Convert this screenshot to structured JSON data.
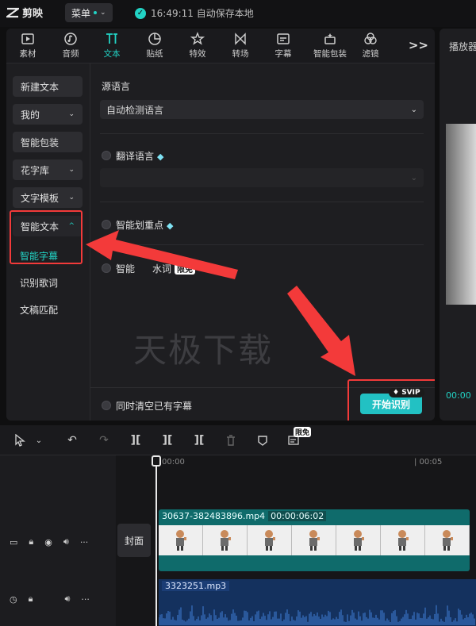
{
  "app": {
    "name": "剪映",
    "menu_label": "菜单",
    "save_status": "16:49:11 自动保存本地"
  },
  "toolbar": {
    "tabs": [
      {
        "label": "素材",
        "icon": "media-icon"
      },
      {
        "label": "音频",
        "icon": "audio-icon"
      },
      {
        "label": "文本",
        "icon": "text-icon",
        "active": true
      },
      {
        "label": "贴纸",
        "icon": "sticker-icon"
      },
      {
        "label": "特效",
        "icon": "effects-icon"
      },
      {
        "label": "转场",
        "icon": "transition-icon"
      },
      {
        "label": "字幕",
        "icon": "subtitle-icon"
      },
      {
        "label": "智能包装",
        "icon": "smart-pack-icon"
      },
      {
        "label": "滤镜",
        "icon": "filter-icon"
      }
    ],
    "more": ">>"
  },
  "sidebar": {
    "new_text": "新建文本",
    "mine": "我的",
    "smart_pack": "智能包装",
    "font_library": "花字库",
    "text_template": "文字模板",
    "smart_text": "智能文本",
    "smart_subtitle": "智能字幕",
    "lyrics": "识别歌词",
    "doc_match": "文稿匹配"
  },
  "content": {
    "source_language_label": "源语言",
    "source_language_value": "自动检测语言",
    "translate_label": "翻译语言",
    "highlight_label": "智能划重点",
    "keyword_label_a": "智能",
    "keyword_label_b": "水词",
    "limit_tag": "限免",
    "clear_label": "同时清空已有字幕",
    "start_button": "开始识别",
    "svip": "SVIP",
    "watermark": "天极下载"
  },
  "preview": {
    "title": "播放器",
    "time": "00:00"
  },
  "timeline": {
    "limit_tag": "限免",
    "ruler_start": "00:00",
    "ruler_mark": "| 00:05",
    "cover_label": "封面",
    "video_name": "30637-382483896.mp4",
    "video_duration": "00:00:06:02",
    "audio_name": "3323251.mp3"
  },
  "colors": {
    "accent": "#22d3c5",
    "highlight": "#f33a3a"
  }
}
